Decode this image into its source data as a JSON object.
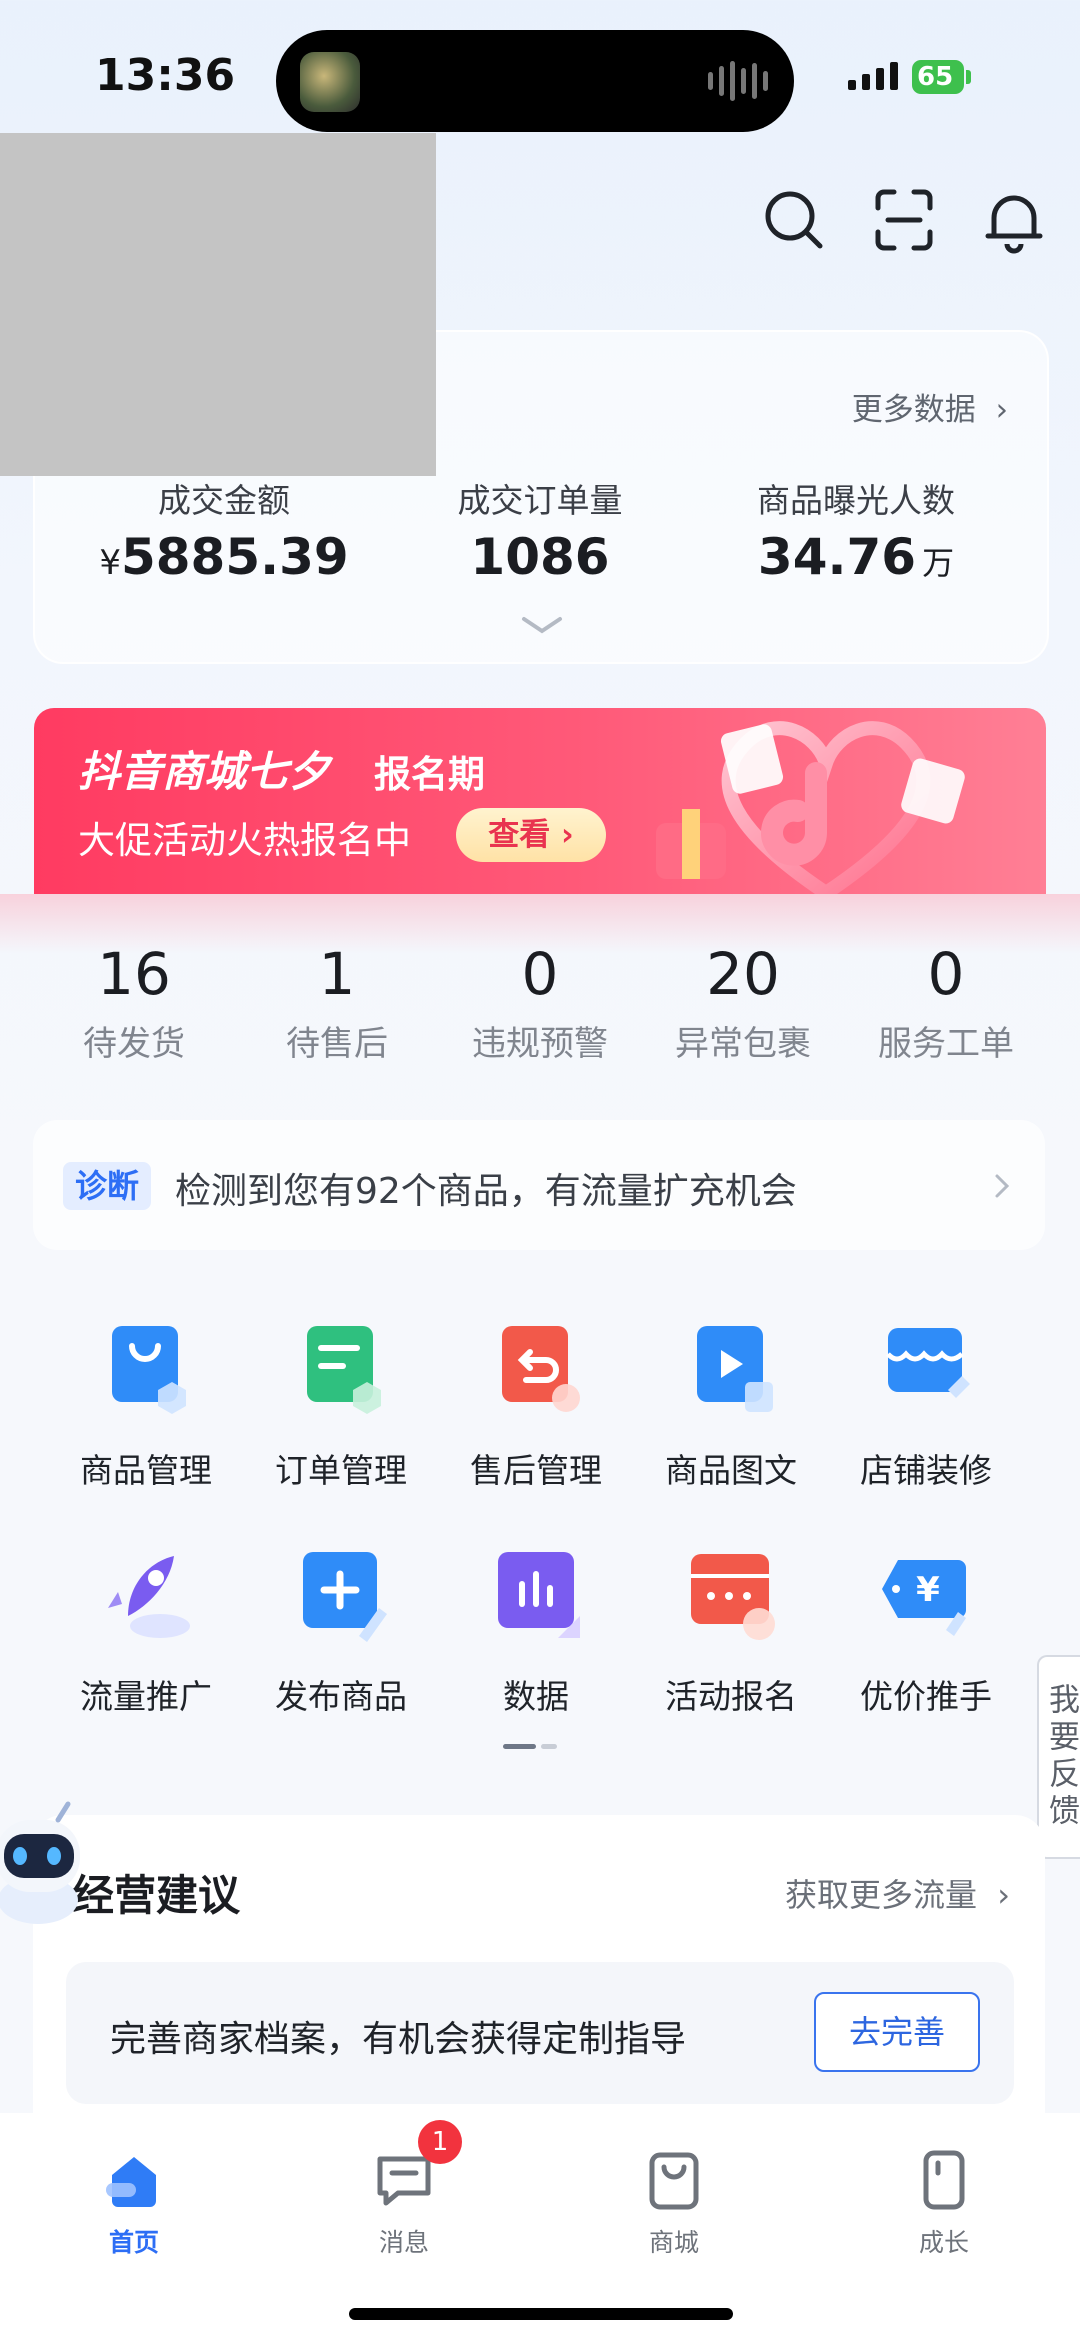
{
  "status_bar": {
    "time": "13:36",
    "battery": "65"
  },
  "stats": {
    "more_label": "更多数据",
    "items": [
      {
        "label": "成交金额",
        "prefix": "¥",
        "value": "5885.39",
        "unit": ""
      },
      {
        "label": "成交订单量",
        "prefix": "",
        "value": "1086",
        "unit": ""
      },
      {
        "label": "商品曝光人数",
        "prefix": "",
        "value": "34.76",
        "unit": "万"
      }
    ]
  },
  "banner": {
    "title": "抖音商城七夕",
    "tag": "报名期",
    "subtitle": "大促活动火热报名中",
    "button": "查看 ›"
  },
  "counters": [
    {
      "value": "16",
      "label": "待发货"
    },
    {
      "value": "1",
      "label": "待售后"
    },
    {
      "value": "0",
      "label": "违规预警"
    },
    {
      "value": "20",
      "label": "异常包裹"
    },
    {
      "value": "0",
      "label": "服务工单"
    }
  ],
  "diagnosis": {
    "tag": "诊断",
    "text": "检测到您有92个商品，有流量扩充机会"
  },
  "tools": [
    {
      "label": "商品管理",
      "icon": "bag-icon",
      "color": "#2f8cf8"
    },
    {
      "label": "订单管理",
      "icon": "order-list-icon",
      "color": "#2fc07f"
    },
    {
      "label": "售后管理",
      "icon": "return-icon",
      "color": "#f2594a"
    },
    {
      "label": "商品图文",
      "icon": "video-card-icon",
      "color": "#2f8cf8"
    },
    {
      "label": "店铺装修",
      "icon": "shop-icon",
      "color": "#2f8cf8"
    },
    {
      "label": "流量推广",
      "icon": "rocket-icon",
      "color": "#7a5cf0"
    },
    {
      "label": "发布商品",
      "icon": "add-icon",
      "color": "#2f8cf8"
    },
    {
      "label": "数据",
      "icon": "bar-chart-icon",
      "color": "#7a5cf0"
    },
    {
      "label": "活动报名",
      "icon": "calendar-icon",
      "color": "#f2594a"
    },
    {
      "label": "优价推手",
      "icon": "price-tag-icon",
      "color": "#2f8cf8"
    }
  ],
  "feedback": "我要反馈",
  "advice": {
    "title": "经营建议",
    "more": "获取更多流量",
    "item_text": "完善商家档案，有机会获得定制指导",
    "item_button": "去完善"
  },
  "tabbar": [
    {
      "label": "首页",
      "icon": "home-icon",
      "active": true
    },
    {
      "label": "消息",
      "icon": "message-icon",
      "active": false
    },
    {
      "label": "商城",
      "icon": "store-bag-icon",
      "active": false
    },
    {
      "label": "成长",
      "icon": "growth-icon",
      "active": false
    }
  ],
  "message_badge": "1"
}
